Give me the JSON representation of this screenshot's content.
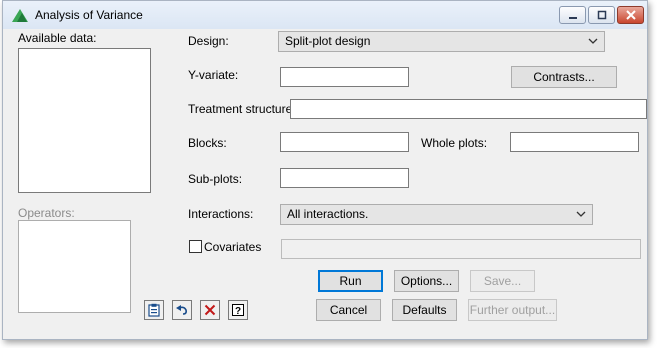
{
  "window": {
    "title": "Analysis of Variance"
  },
  "left": {
    "available_label": "Available data:",
    "operators_label": "Operators:"
  },
  "form": {
    "design_label": "Design:",
    "design_value": "Split-plot design",
    "yvariate_label": "Y-variate:",
    "contrasts_label": "Contrasts...",
    "treatment_label": "Treatment structure:",
    "blocks_label": "Blocks:",
    "wholeplots_label": "Whole plots:",
    "subplots_label": "Sub-plots:",
    "interactions_label": "Interactions:",
    "interactions_value": "All interactions.",
    "covariates_label": "Covariates"
  },
  "buttons": {
    "run": "Run",
    "options": "Options...",
    "save": "Save...",
    "cancel": "Cancel",
    "defaults": "Defaults",
    "further_output": "Further output..."
  },
  "toolbar_icons": [
    "clipboard-icon",
    "undo-icon",
    "clear-icon",
    "help-icon"
  ]
}
